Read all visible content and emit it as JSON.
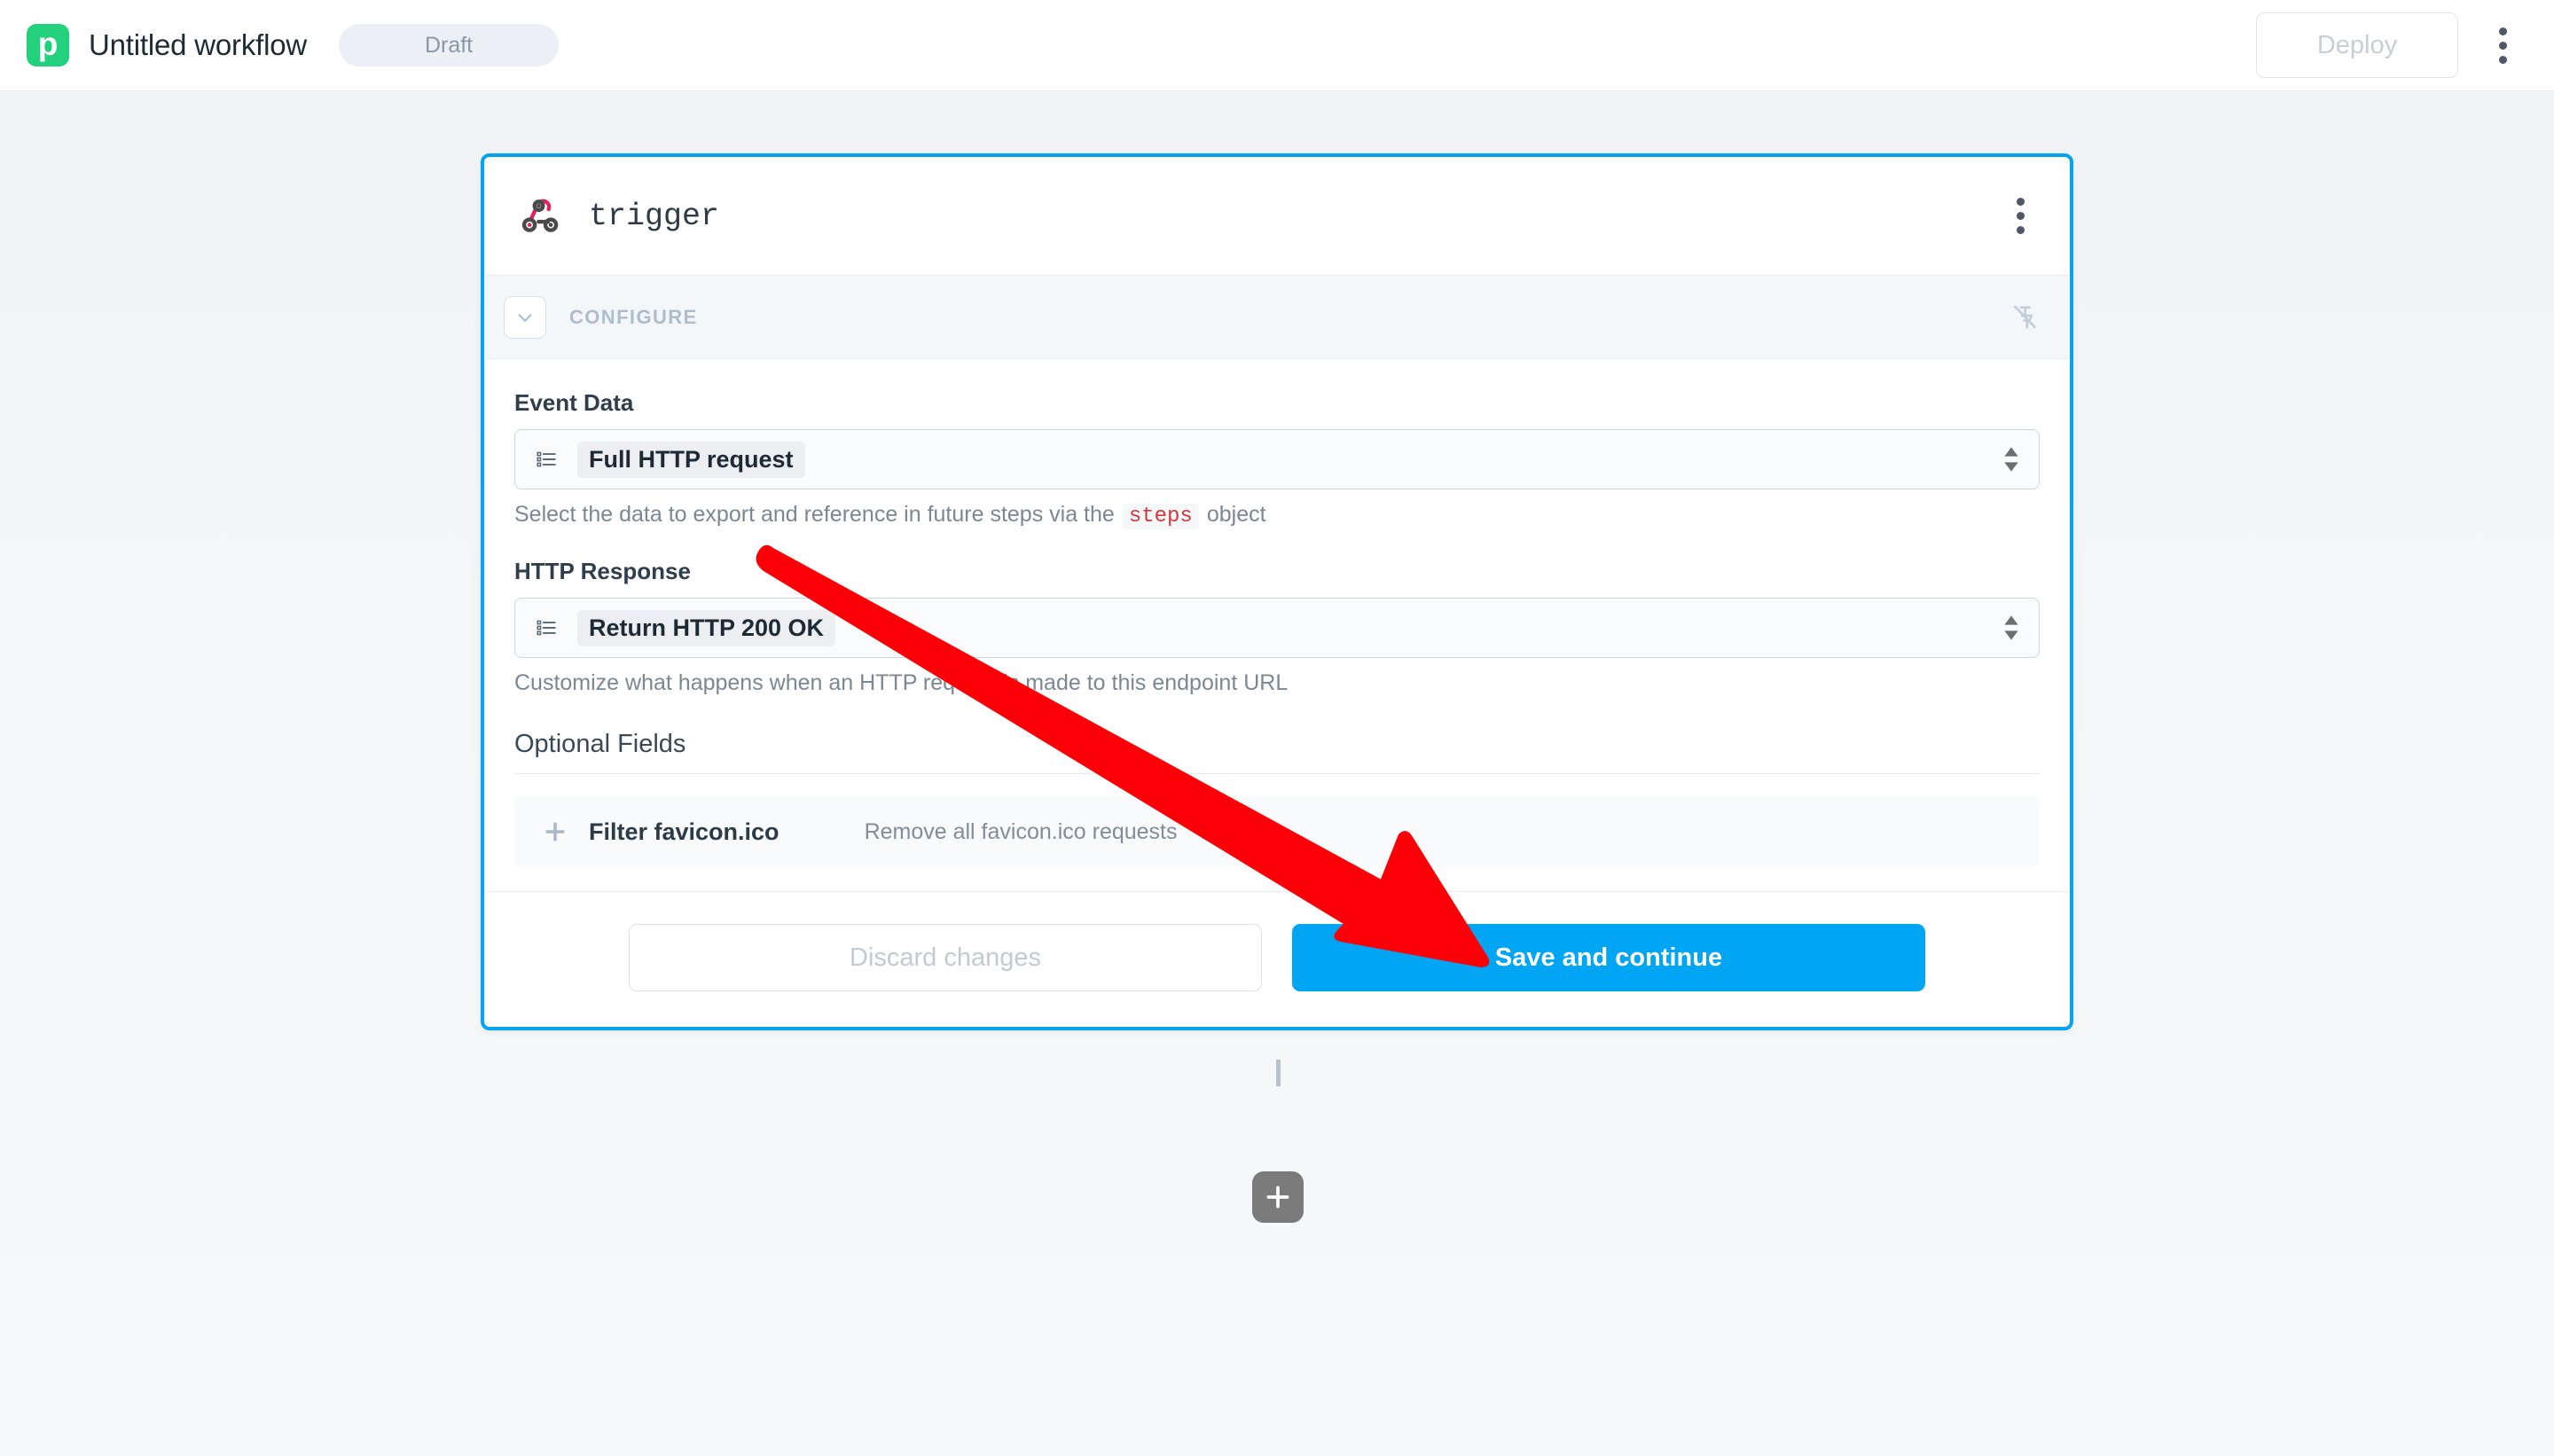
{
  "header": {
    "logo_icon": "pipedream-logo-icon",
    "logo_letter": "p",
    "workflow_title": "Untitled workflow",
    "status_badge": "Draft",
    "deploy_label": "Deploy",
    "menu_icon": "kebab-menu-icon"
  },
  "card": {
    "step_icon": "webhook-icon",
    "step_name": "trigger",
    "menu_icon": "kebab-menu-icon",
    "configure": {
      "collapse_icon": "chevron-down-icon",
      "label": "CONFIGURE",
      "pin_icon": "pin-off-icon"
    },
    "fields": [
      {
        "label": "Event Data",
        "select_icon": "list-icon",
        "value": "Full HTTP request",
        "spinner_icon": "updown-arrows-icon",
        "hint_before": "Select the data to export and reference in future steps via the",
        "hint_code": "steps",
        "hint_after": "object"
      },
      {
        "label": "HTTP Response",
        "select_icon": "list-icon",
        "value": "Return HTTP 200 OK",
        "spinner_icon": "updown-arrows-icon",
        "hint_before": "Customize what happens when an HTTP request is made to this endpoint URL",
        "hint_code": "",
        "hint_after": ""
      }
    ],
    "optional": {
      "title": "Optional Fields",
      "rows": [
        {
          "add_icon": "plus-icon",
          "name": "Filter favicon.ico",
          "description": "Remove all favicon.ico requests"
        }
      ]
    },
    "actions": {
      "discard_label": "Discard changes",
      "save_label": "Save and continue"
    }
  },
  "canvas": {
    "add_step_icon": "plus-icon",
    "add_step_label": ""
  },
  "annotation": {
    "arrow_icon": "red-arrow-pointer",
    "arrow_color": "#fb0006",
    "points_to": "Save and continue"
  },
  "colors": {
    "accent_blue": "#00a6f4",
    "card_border": "#03a3f4",
    "logo_green": "#23d07c",
    "webhook_pink": "#e0245e",
    "code_red": "#d4383c"
  }
}
